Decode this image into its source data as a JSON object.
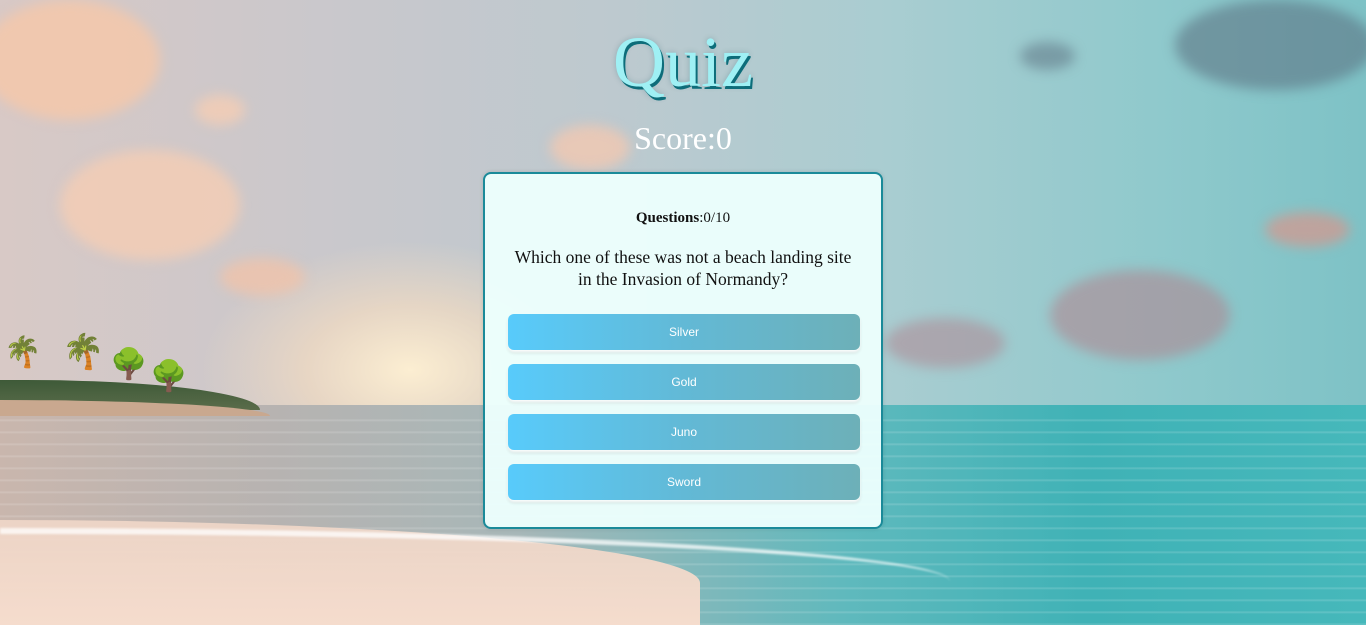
{
  "header": {
    "title": "Quiz"
  },
  "score": {
    "label": "Score:",
    "value": "0"
  },
  "card": {
    "questions_label": "Questions",
    "questions_progress": ":0/10",
    "question_text": "Which one of these was not a beach landing site in the Invasion of Normandy?",
    "answers": [
      {
        "label": "Silver"
      },
      {
        "label": "Gold"
      },
      {
        "label": "Juno"
      },
      {
        "label": "Sword"
      }
    ]
  },
  "colors": {
    "title": "#9ff0f4",
    "card_border": "#1a8a99",
    "button_start": "#58cbfb",
    "button_end": "#6db0b8"
  }
}
